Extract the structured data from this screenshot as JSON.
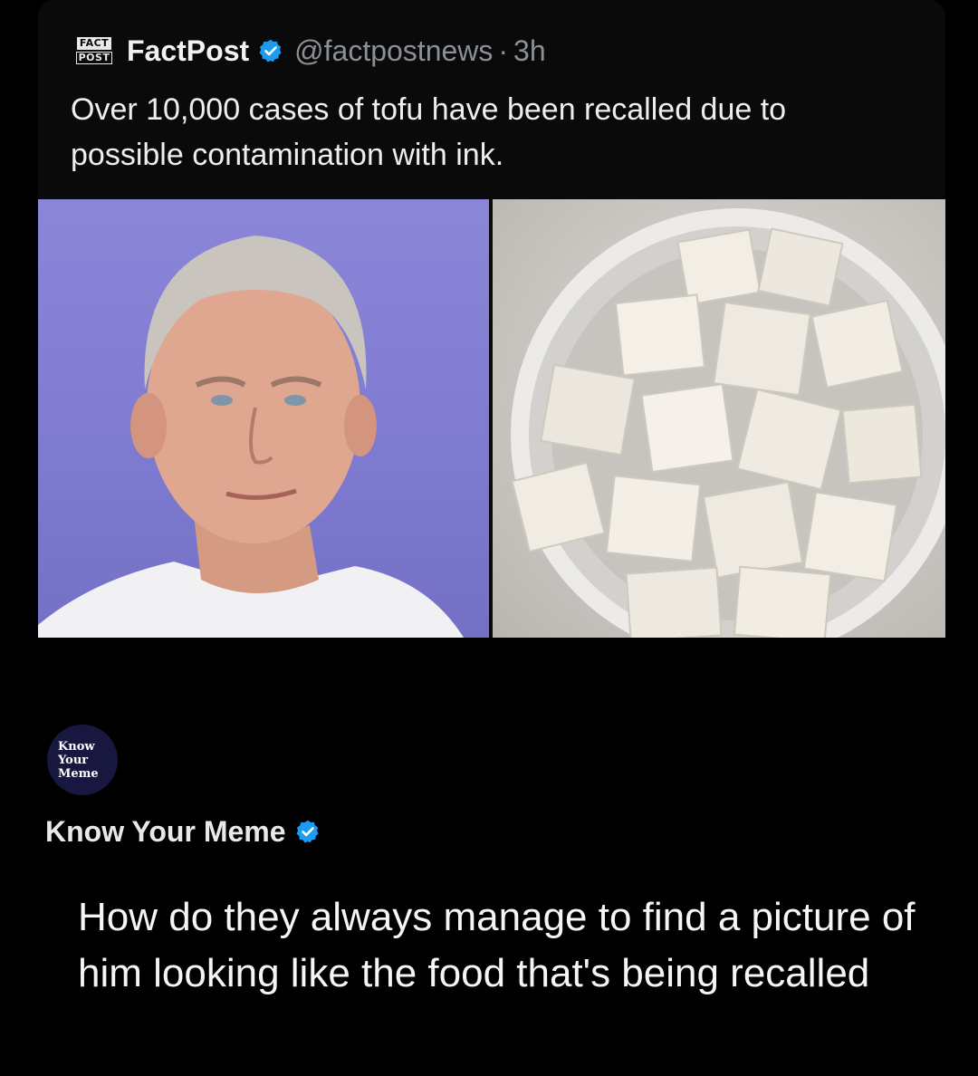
{
  "tweet": {
    "logo_lines": [
      "FACT",
      "POST"
    ],
    "author_name": "FactPost",
    "handle": "@factpostnews",
    "time": "3h",
    "text": "Over 10,000 cases of tofu have been recalled due to possible contamination with ink.",
    "media": [
      "person-photo",
      "tofu-bowl-photo"
    ]
  },
  "reply": {
    "avatar_lines": [
      "Know",
      "Your",
      "Meme"
    ],
    "author_name": "Know Your Meme",
    "text": "How do they always manage to find a picture of him looking like the food that's being recalled"
  },
  "colors": {
    "background": "#000000",
    "verified_blue": "#1d9bf0",
    "handle_gray": "#8b9097",
    "photo_backdrop": "#807cd2",
    "avatar_navy": "#17173f"
  },
  "icons": [
    "factpost-logo",
    "verified-badge-icon",
    "know-your-meme-logo"
  ]
}
